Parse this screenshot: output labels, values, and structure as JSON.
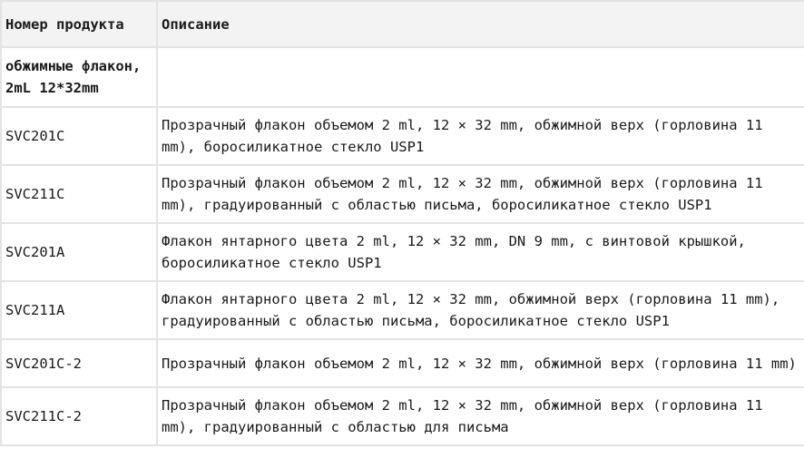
{
  "table": {
    "headers": {
      "code": "Номер продукта",
      "description": "Описание"
    },
    "group": {
      "label": "обжимные флакон, 2mL 12*32mm",
      "description": ""
    },
    "rows": [
      {
        "code": "SVC201C",
        "description": "Прозрачный флакон объемом 2 ml, 12 × 32 mm, обжимной верх (горловина 11 mm), боросиликатное стекло USP1"
      },
      {
        "code": "SVC211C",
        "description": "Прозрачный флакон объемом 2 ml, 12 × 32 mm, обжимной верх (горловина 11 mm), градуированный с областью письма, боросиликатное стекло USP1"
      },
      {
        "code": "SVC201A",
        "description": "Флакон янтарного цвета 2 ml, 12 × 32 mm, DN 9 mm, с винтовой крышкой, боросиликатное стекло USP1"
      },
      {
        "code": "SVC211A",
        "description": "Флакон янтарного цвета 2 ml, 12 × 32 mm, обжимной верх (горловина 11 mm), градуированный с областью письма, боросиликатное стекло USP1"
      },
      {
        "code": "SVC201C-2",
        "description": "Прозрачный флакон объемом 2 ml, 12 × 32 mm, обжимной верх (горловина 11 mm)"
      },
      {
        "code": "SVC211C-2",
        "description": "Прозрачный флакон объемом 2 ml, 12 × 32 mm, обжимной верх (горловина 11 mm), градуированный с областью для письма"
      }
    ]
  }
}
